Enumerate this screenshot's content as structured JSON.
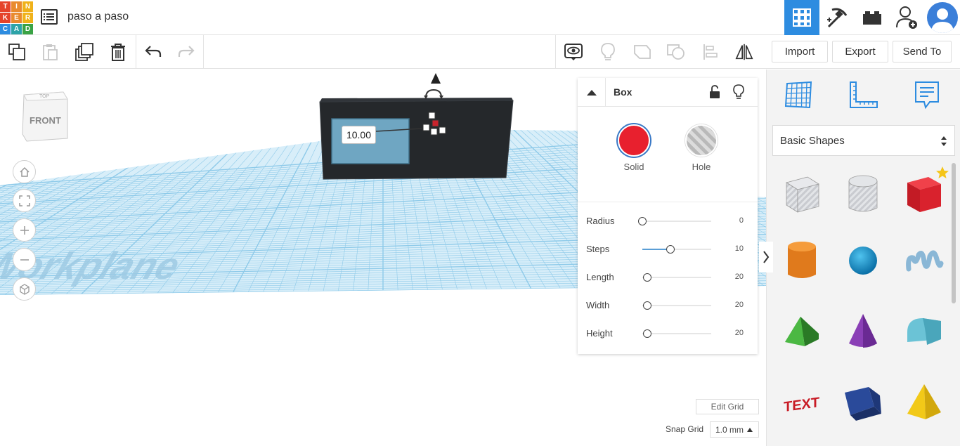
{
  "app": {
    "logo_letters": [
      "T",
      "I",
      "N",
      "K",
      "E",
      "R",
      "C",
      "A",
      "D"
    ],
    "logo_colors": [
      "#e5432a",
      "#e98a2e",
      "#f0b21a",
      "#e5432a",
      "#e98a2e",
      "#f0b21a",
      "#2d8ce0",
      "#2da3a8",
      "#3aa345"
    ],
    "document_title": "paso a paso"
  },
  "toolbar": {
    "right_buttons": [
      "Import",
      "Export",
      "Send To"
    ]
  },
  "workspace": {
    "viewcube_face": "FRONT",
    "viewcube_top": "TOP",
    "workplane_text": "Workplane",
    "dimension_value": "10.00"
  },
  "inspector": {
    "title": "Box",
    "modes": [
      {
        "label": "Solid",
        "color": "#e8202e",
        "selected": true
      },
      {
        "label": "Hole",
        "color": "#b9b9b9",
        "selected": false
      }
    ],
    "properties": [
      {
        "label": "Radius",
        "value": "0",
        "fraction": 0.0
      },
      {
        "label": "Steps",
        "value": "10",
        "fraction": 0.41
      },
      {
        "label": "Length",
        "value": "20",
        "fraction": 0.07
      },
      {
        "label": "Width",
        "value": "20",
        "fraction": 0.07
      },
      {
        "label": "Height",
        "value": "20",
        "fraction": 0.07
      }
    ]
  },
  "shapes_panel": {
    "category": "Basic Shapes",
    "items": [
      "box-hole",
      "cylinder-hole",
      "box",
      "cylinder",
      "sphere",
      "scribble",
      "roof",
      "cone",
      "round-roof",
      "text",
      "wedge",
      "pyramid"
    ]
  },
  "grid": {
    "edit_label": "Edit Grid",
    "snap_label": "Snap Grid",
    "snap_value": "1.0 mm"
  },
  "colors": {
    "accent": "#2d8ce0",
    "grid": "#8ecae9",
    "block": "#25282b"
  }
}
